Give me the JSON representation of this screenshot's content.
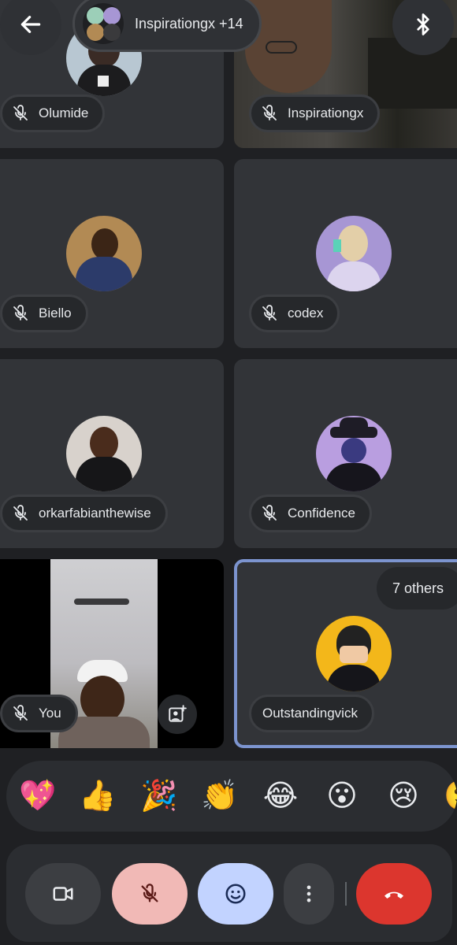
{
  "header": {
    "back_icon": "arrow-left-icon",
    "meeting_chip_label": "Inspirationgx +14",
    "bluetooth_icon": "bluetooth-icon"
  },
  "participants": [
    {
      "name": "Olumide",
      "muted": true
    },
    {
      "name": "Inspirationgx",
      "muted": true
    },
    {
      "name": "Biello",
      "muted": true
    },
    {
      "name": "codex",
      "muted": true
    },
    {
      "name": "orkarfabianthewise",
      "muted": true
    },
    {
      "name": "Confidence",
      "muted": true
    },
    {
      "name": "You",
      "muted": true
    },
    {
      "name": "Outstandingvick",
      "muted": true
    }
  ],
  "others_label": "7 others",
  "reactions": [
    "💖",
    "👍",
    "🎉",
    "👏",
    "😂",
    "😮",
    "😢",
    "🙂"
  ],
  "controls": {
    "camera_icon": "videocam-icon",
    "mic_icon": "mic-off-icon",
    "reactions_icon": "emoji-icon",
    "more_icon": "more-vert-icon",
    "hangup_icon": "call-end-icon"
  },
  "colors": {
    "background": "#1f2023",
    "tile": "#323438",
    "mic_button": "#f1b9b6",
    "emoji_button": "#c2d3ff",
    "hangup_button": "#dc362e",
    "active_speaker_border": "#7c94cf"
  }
}
